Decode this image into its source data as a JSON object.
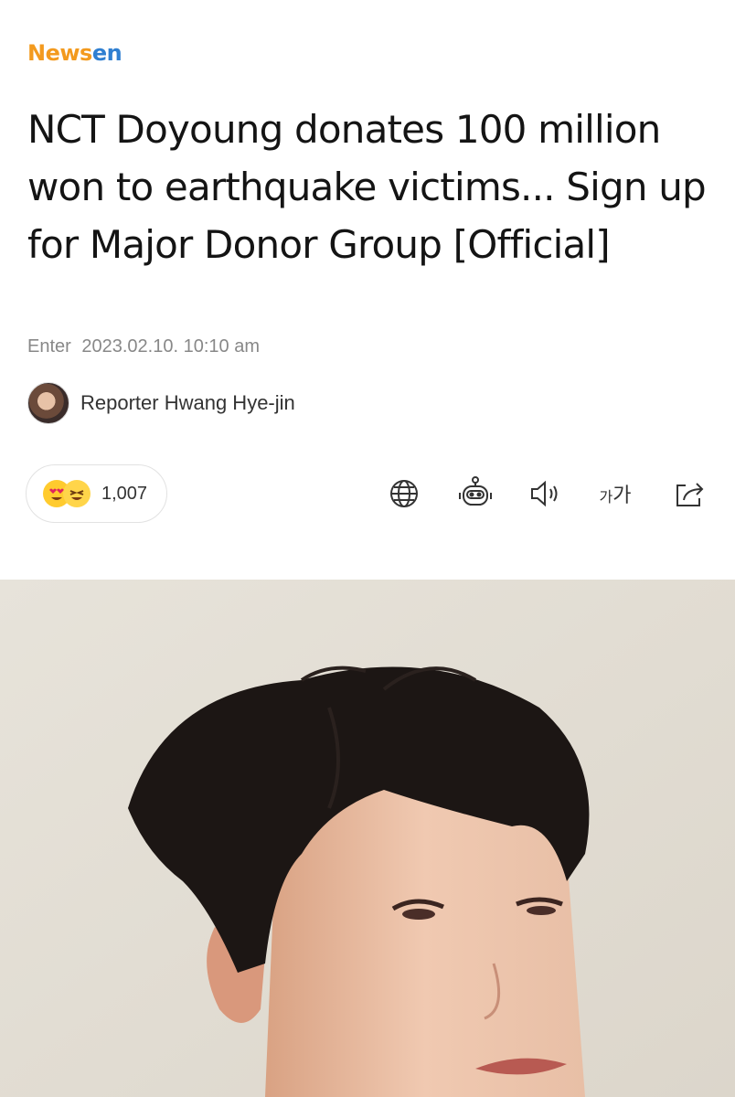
{
  "brand": {
    "part1": "News",
    "part2": "en"
  },
  "article": {
    "title": "NCT Doyoung donates 100 million won to earthquake victims... Sign up for Major Donor Group [Official]",
    "meta_label": "Enter",
    "meta_datetime": "2023.02.10. 10:10 am",
    "reporter": "Reporter Hwang Hye-jin"
  },
  "reactions": {
    "count": "1,007"
  },
  "toolbar": {
    "icons": [
      "globe-icon",
      "robot-icon",
      "speaker-icon",
      "font-size-icon",
      "share-icon"
    ],
    "font_size_label_small": "가",
    "font_size_label_large": "가"
  },
  "colors": {
    "brand_orange": "#f39a1e",
    "brand_blue": "#2f7fd1",
    "meta_gray": "#888888"
  }
}
